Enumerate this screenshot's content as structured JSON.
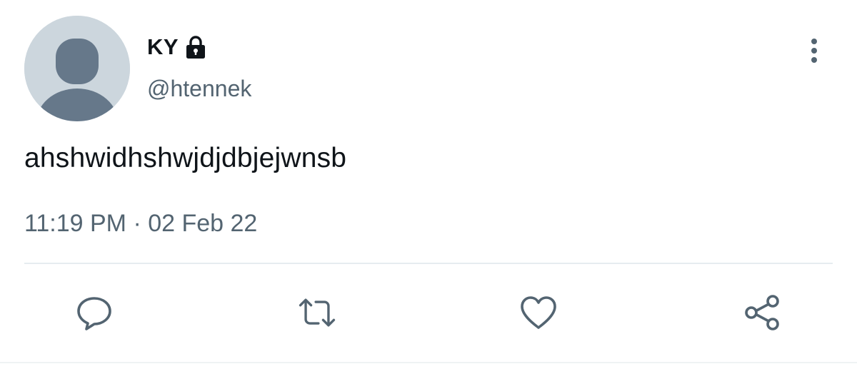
{
  "user": {
    "display_name": "KY",
    "handle": "@htennek",
    "avatar": "default-avatar",
    "protected_icon": "lock-icon"
  },
  "tweet": {
    "text": "ahshwidhshwjdjdbjejwnsb",
    "time": "11:19 PM",
    "separator": "·",
    "date": "02 Feb 22",
    "meta": "11:19 PM · 02 Feb 22"
  },
  "menu": {
    "icon": "more-vertical-icon"
  },
  "actions": [
    {
      "name": "reply",
      "icon": "reply-icon"
    },
    {
      "name": "retweet",
      "icon": "retweet-icon"
    },
    {
      "name": "like",
      "icon": "heart-icon"
    },
    {
      "name": "share",
      "icon": "share-icon"
    }
  ],
  "colors": {
    "text_primary": "#0f1419",
    "text_secondary": "#536471",
    "avatar_bg": "#ccd6dd",
    "avatar_fg": "#66788a",
    "divider": "#e6ecf0"
  }
}
